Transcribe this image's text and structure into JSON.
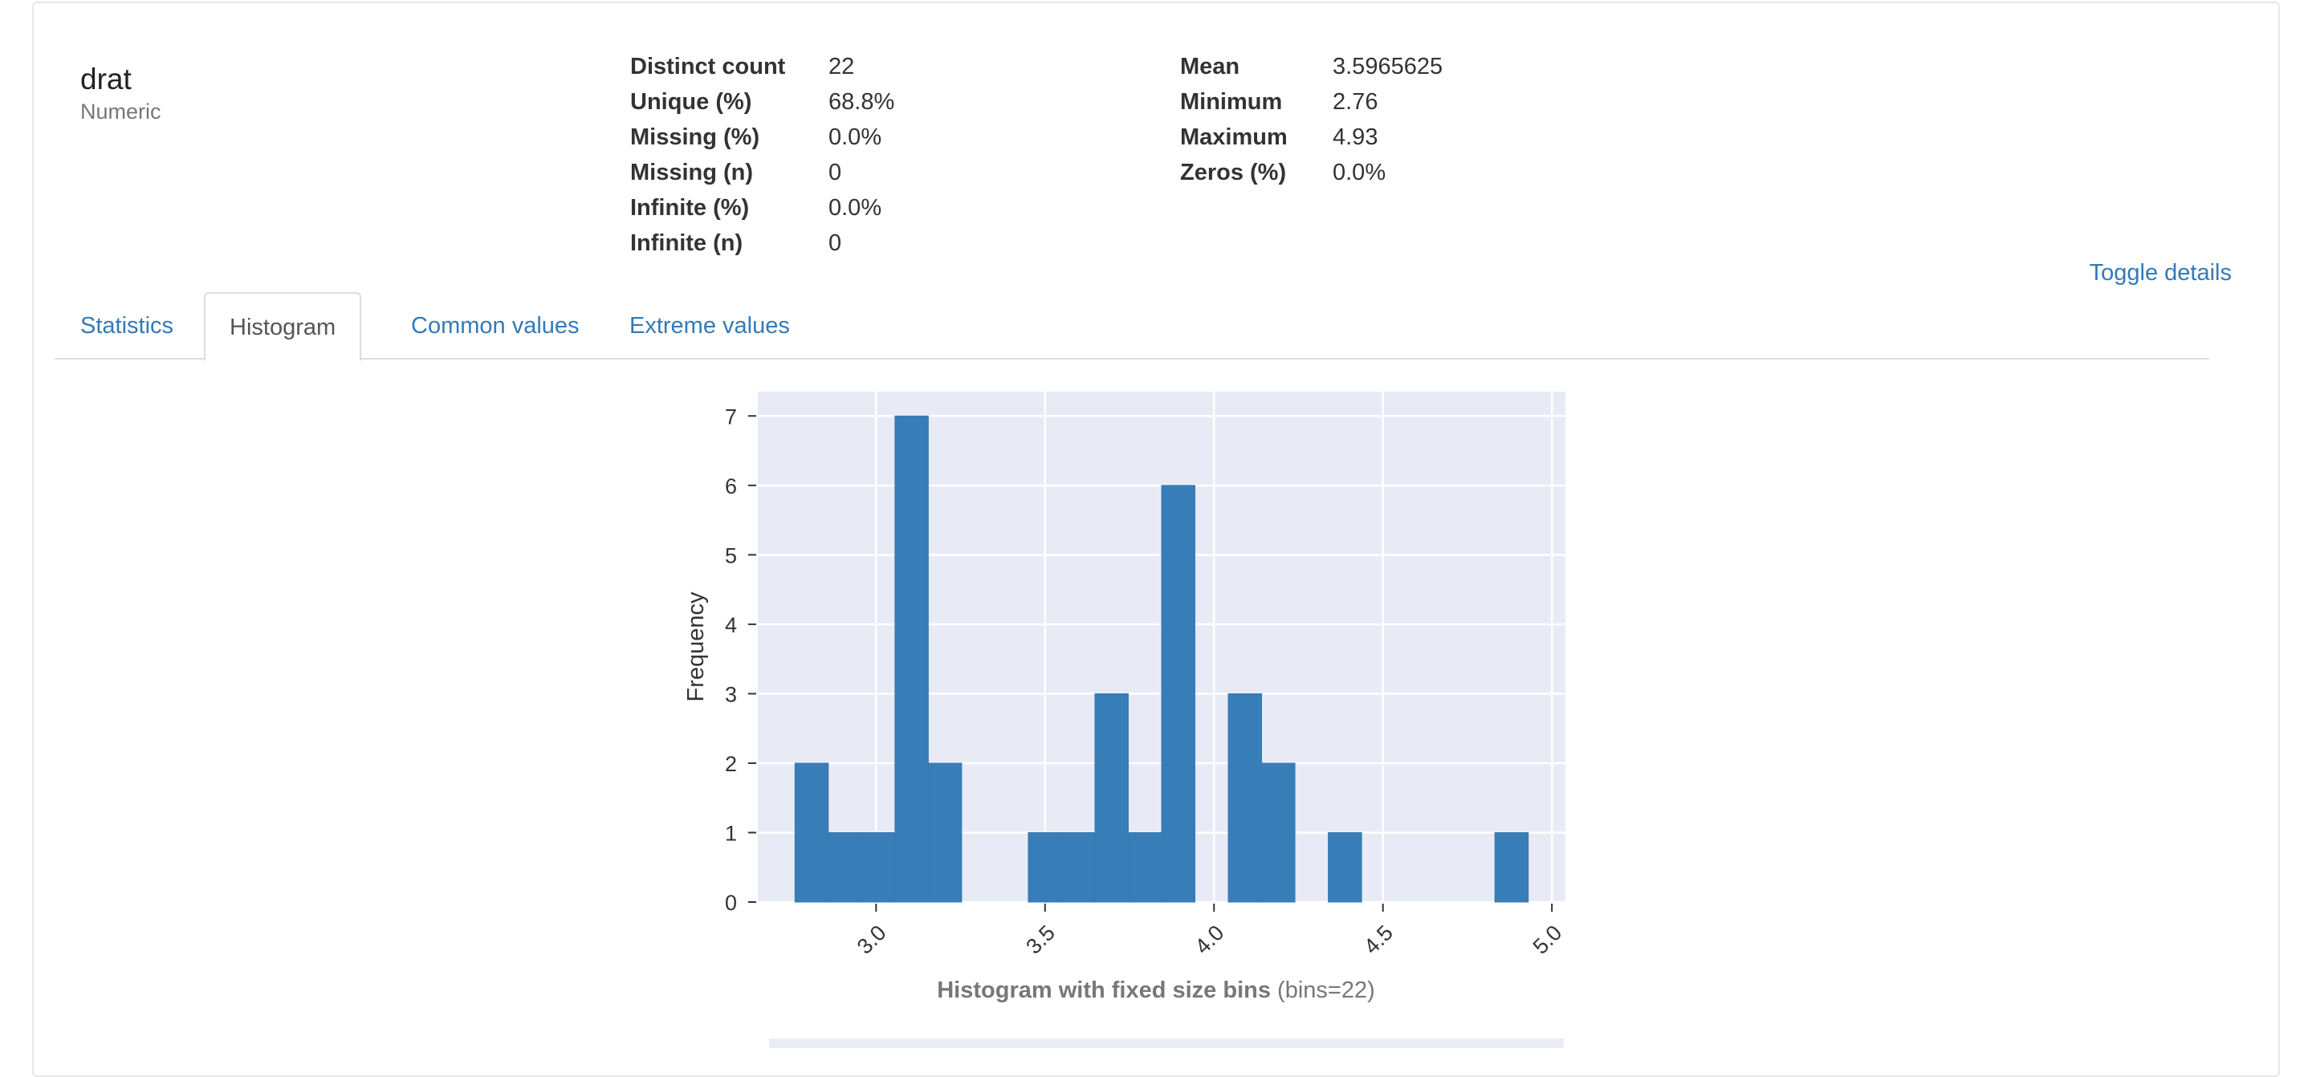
{
  "variable": {
    "name": "drat",
    "type": "Numeric"
  },
  "stats_left": [
    {
      "key": "Distinct count",
      "value": "22"
    },
    {
      "key": "Unique (%)",
      "value": "68.8%"
    },
    {
      "key": "Missing (%)",
      "value": "0.0%"
    },
    {
      "key": "Missing (n)",
      "value": "0"
    },
    {
      "key": "Infinite (%)",
      "value": "0.0%"
    },
    {
      "key": "Infinite (n)",
      "value": "0"
    }
  ],
  "stats_right": [
    {
      "key": "Mean",
      "value": "3.5965625"
    },
    {
      "key": "Minimum",
      "value": "2.76"
    },
    {
      "key": "Maximum",
      "value": "4.93"
    },
    {
      "key": "Zeros (%)",
      "value": "0.0%"
    }
  ],
  "toggle_label": "Toggle details",
  "tabs": [
    {
      "label": "Statistics"
    },
    {
      "label": "Histogram"
    },
    {
      "label": "Common values"
    },
    {
      "label": "Extreme values"
    }
  ],
  "active_tab": "Histogram",
  "caption": {
    "bold": "Histogram with fixed size bins",
    "rest": " (bins=22)"
  },
  "chart_data": {
    "type": "bar",
    "ylabel": "Frequency",
    "xlabel": "",
    "xlim": [
      2.65,
      5.04
    ],
    "ylim": [
      0,
      7.35
    ],
    "x_ticks": [
      "3.0",
      "3.5",
      "4.0",
      "4.5",
      "5.0"
    ],
    "y_ticks": [
      "0",
      "1",
      "2",
      "3",
      "4",
      "5",
      "6",
      "7"
    ],
    "bin_start": 2.76,
    "bin_end": 4.93,
    "bins": 22,
    "values": [
      2,
      1,
      1,
      7,
      2,
      0,
      0,
      1,
      1,
      3,
      1,
      6,
      0,
      3,
      2,
      0,
      1,
      0,
      0,
      0,
      0,
      1
    ],
    "grid": true,
    "bar_color": "#337ab7",
    "background_color": "#e8ebf5"
  }
}
